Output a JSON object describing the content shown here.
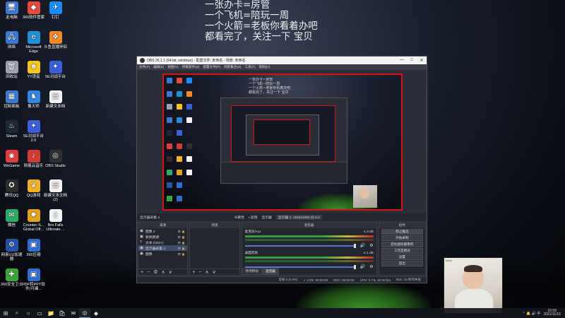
{
  "desktop": {
    "icons": [
      {
        "label": "此电脑",
        "glyph": "🖥",
        "color": "#3a7bd5"
      },
      {
        "label": "360软件管家",
        "glyph": "◆",
        "color": "#e64a3c"
      },
      {
        "label": "钉钉",
        "glyph": "✈",
        "color": "#1a8cff"
      },
      {
        "label": "网络",
        "glyph": "🖧",
        "color": "#3a7bd5"
      },
      {
        "label": "Microsoft Edge",
        "glyph": "e",
        "color": "#1f8fd6"
      },
      {
        "label": "斗鱼直播伴侣",
        "glyph": "❖",
        "color": "#f08a24"
      },
      {
        "label": "回收站",
        "glyph": "🗑",
        "color": "#9aa4b5"
      },
      {
        "label": "YY语音",
        "glyph": "☻",
        "color": "#f5c518"
      },
      {
        "label": "5E对战平台",
        "glyph": "✦",
        "color": "#3b5fd9"
      },
      {
        "label": "控制面板",
        "glyph": "▦",
        "color": "#3a7bd5"
      },
      {
        "label": "鲁大师",
        "glyph": "♞",
        "color": "#2f87e0"
      },
      {
        "label": "新建文本档",
        "glyph": "▤",
        "color": "#f2f2f2"
      },
      {
        "label": "Steam",
        "glyph": "♨",
        "color": "#1b2838"
      },
      {
        "label": "5E对战平台 2.0",
        "glyph": "✦",
        "color": "#3b5fd9"
      },
      {
        "label": "WeGame",
        "glyph": "◉",
        "color": "#e23b3b"
      },
      {
        "label": "网易云音乐",
        "glyph": "♪",
        "color": "#d43c33"
      },
      {
        "label": "OBS Studio",
        "glyph": "◎",
        "color": "#302e31"
      },
      {
        "label": "腾讯QQ",
        "glyph": "✪",
        "color": "#2d2d2d"
      },
      {
        "label": "QQ游戏",
        "glyph": "♛",
        "color": "#f7b21b"
      },
      {
        "label": "新建文本文档 (2)",
        "glyph": "▤",
        "color": "#f2f2f2"
      },
      {
        "label": "微信",
        "glyph": "✉",
        "color": "#2aae67"
      },
      {
        "label": "Counter-S... Global Off...",
        "glyph": "✸",
        "color": "#e3a21a"
      },
      {
        "label": "Bro Falls Ultimate ...",
        "glyph": "▯",
        "color": "#f2f2f2"
      },
      {
        "label": "网易UU加速器",
        "glyph": "⚙",
        "color": "#2253a8"
      },
      {
        "label": "360压缩",
        "glyph": "▣",
        "color": "#2f6fd1"
      },
      {
        "label": "360安全卫士",
        "glyph": "✚",
        "color": "#3aa63a"
      },
      {
        "label": "PDF转PPT软件(可编...",
        "glyph": "▣",
        "color": "#2f6fd1"
      }
    ]
  },
  "overlay_lines": [
    "一张办卡=房管",
    "一个飞机=陪玩一周",
    "一个火箭=老板你看着办吧",
    "都看完了，关注一下 宝贝"
  ],
  "obs": {
    "title": "OBS 26.1.1 (64-bit, windows) - 配置文件: 未命名 - 场景: 未命名",
    "menu": [
      "文件(F)",
      "编辑(E)",
      "视图(V)",
      "停靠部件(D)",
      "配置文件(P)",
      "场景集合(S)",
      "工具(T)",
      "帮助(H)"
    ],
    "source_toolbar": {
      "current": "显示器采集 3",
      "properties": "⚙属性",
      "filters": "◐滤镜",
      "display_label": "显示器",
      "display_value": "显示器 1: 1920x1080 @ 0,0"
    },
    "docks": {
      "scenes_title": "来源",
      "scenes_col": "场景",
      "mixer_title": "混音器",
      "controls_title": "控件"
    },
    "sources": [
      {
        "icon": "▣",
        "name": "图像 2",
        "selected": false
      },
      {
        "icon": "▣",
        "name": "新视频源",
        "selected": false
      },
      {
        "icon": "T",
        "name": "文本 (GDI+)",
        "selected": false
      },
      {
        "icon": "▣",
        "name": "显示器采集 3",
        "selected": true
      },
      {
        "icon": "▣",
        "name": "图像",
        "selected": false
      }
    ],
    "mixer": [
      {
        "name": "麦克风/Aux",
        "db": "-1.6 dB"
      },
      {
        "name": "桌面音频",
        "db": "-1.1 dB"
      }
    ],
    "mixer_tabs": [
      "转场特效",
      "混音器"
    ],
    "controls": [
      "停止推流",
      "开始录制",
      "启动虚拟摄像机",
      "工作室模式",
      "设置",
      "退出"
    ],
    "status": {
      "dropped": "丢帧 0 (0.0%)",
      "live": "LIVE: 00:00:00",
      "rec": "REC: 00:00:00",
      "cpu": "CPU: 0.7%, 60.00 fps",
      "kbps": "kb/s: 10 秒内失败"
    }
  },
  "webcam": {
    "label": "bdbd"
  },
  "taskbar": {
    "items": [
      "⊞",
      "⌕",
      "○",
      "▭",
      "📁",
      "🛍",
      "✉",
      "◎",
      "◆"
    ],
    "tray": "⌃ 🔔 🔊 中",
    "time": "16:59",
    "date": "2021/11/15"
  }
}
